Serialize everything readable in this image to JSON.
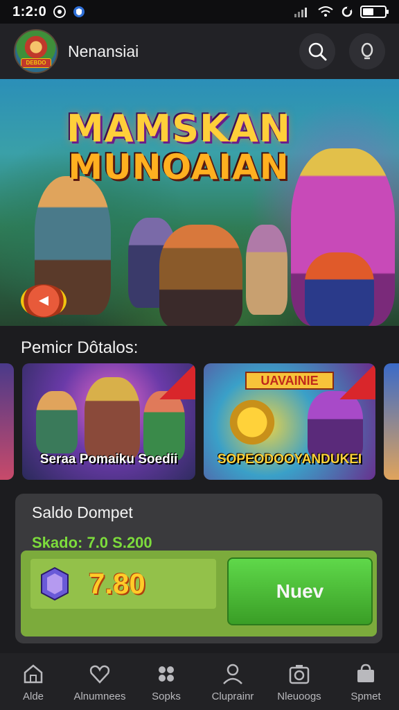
{
  "status_bar": {
    "time": "1:2:0"
  },
  "header": {
    "app_name": "Nenansiai",
    "avatar_tag": "DEBDO"
  },
  "hero": {
    "title_line1": "MAMSKAN",
    "title_line2": "MUNOAIAN"
  },
  "section": {
    "title": "Pemicr Dôtalos:"
  },
  "cards": [
    {
      "label": "Seraa Pomaiku Soedii"
    },
    {
      "label": "SOPEODOOYANDUKEI",
      "banner": "UAVAINIE"
    }
  ],
  "wallet": {
    "title": "Saldo Dompet",
    "balance_text": "Skado: 7.0 S.200",
    "amount": "7.80",
    "button_label": "Nuev"
  },
  "nav": [
    {
      "label": "Alde",
      "icon": "home-icon"
    },
    {
      "label": "Alnumnees",
      "icon": "heart-icon"
    },
    {
      "label": "Sopks",
      "icon": "game-icon"
    },
    {
      "label": "Cluprainr",
      "icon": "profile-icon"
    },
    {
      "label": "Nleuoogs",
      "icon": "camera-icon"
    },
    {
      "label": "Spmet",
      "icon": "bag-icon"
    }
  ],
  "colors": {
    "accent_green": "#5fd84a",
    "balance_green": "#7ddc3c",
    "amount_yellow": "#ffcc29"
  }
}
